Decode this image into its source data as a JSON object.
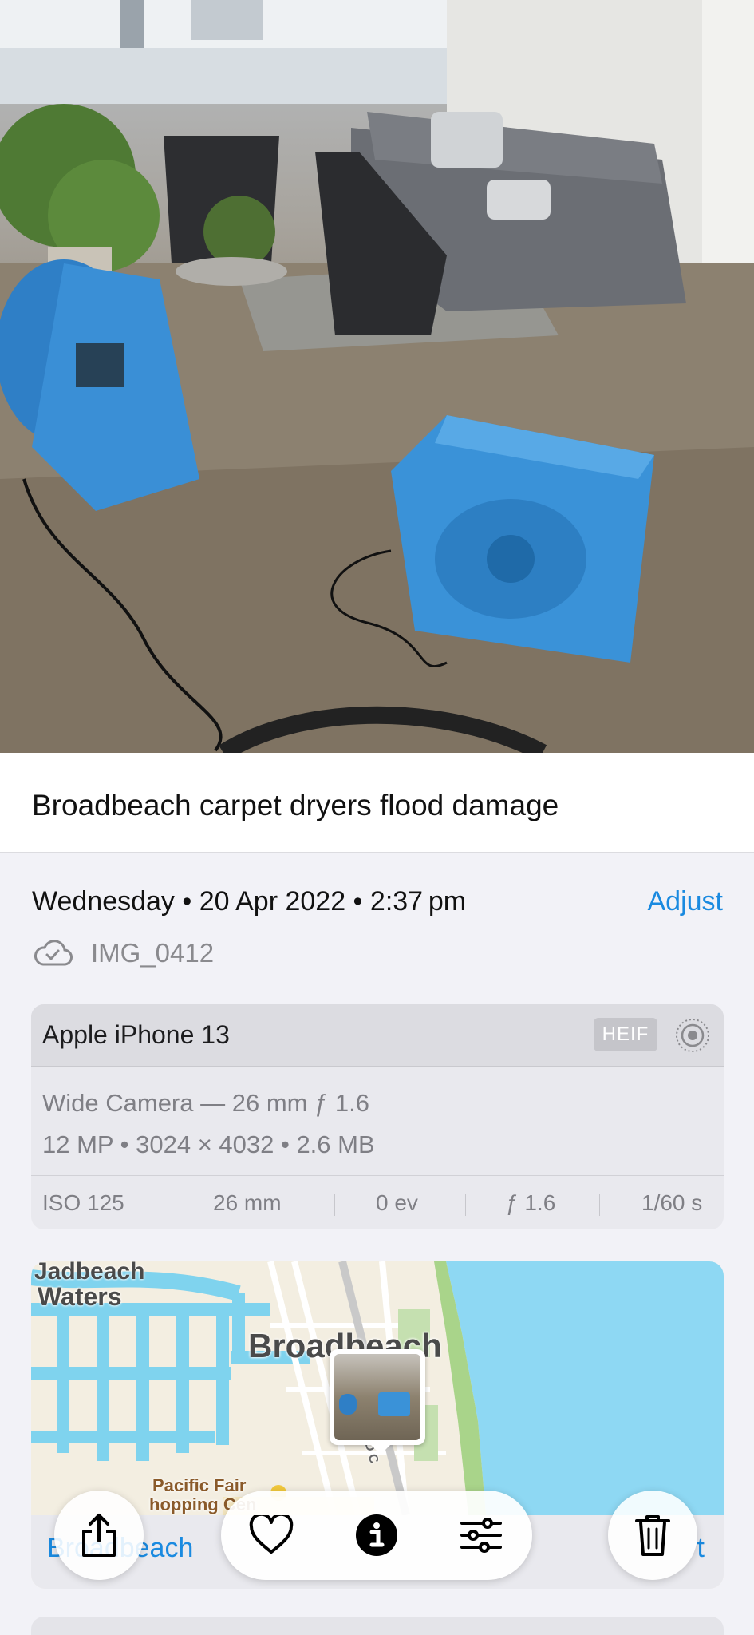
{
  "photo": {
    "alt": "carpet dryers in living room"
  },
  "caption": "Broadbeach carpet dryers flood damage",
  "info": {
    "date_text": "Wednesday • 20 Apr 2022 • 2:37 pm",
    "adjust_label": "Adjust",
    "file_name": "IMG_0412"
  },
  "exif": {
    "device": "Apple iPhone 13",
    "format_badge": "HEIF",
    "lens": "Wide Camera — 26 mm ƒ 1.6",
    "specs": "12 MP • 3024 × 4032 • 2.6 MB",
    "iso": "ISO 125",
    "focal": "26 mm",
    "ev": "0 ev",
    "aperture": "ƒ 1.6",
    "shutter": "1/60 s"
  },
  "map": {
    "labels": {
      "top": "Jadbeach",
      "waters": "Waters",
      "city": "Broadbeach",
      "mall_1": "Pacific Fair",
      "mall_2": "hopping Cen",
      "road": "OLD C"
    },
    "place_link": "Broadbeach",
    "edit_link": "t"
  },
  "toolbar": {
    "share": "share-icon",
    "favorite": "heart-icon",
    "info": "info-icon",
    "edit": "sliders-icon",
    "delete": "trash-icon"
  },
  "colors": {
    "accent": "#1a8ae0",
    "water": "#7fd3ee",
    "sea": "#8ed8f3"
  }
}
